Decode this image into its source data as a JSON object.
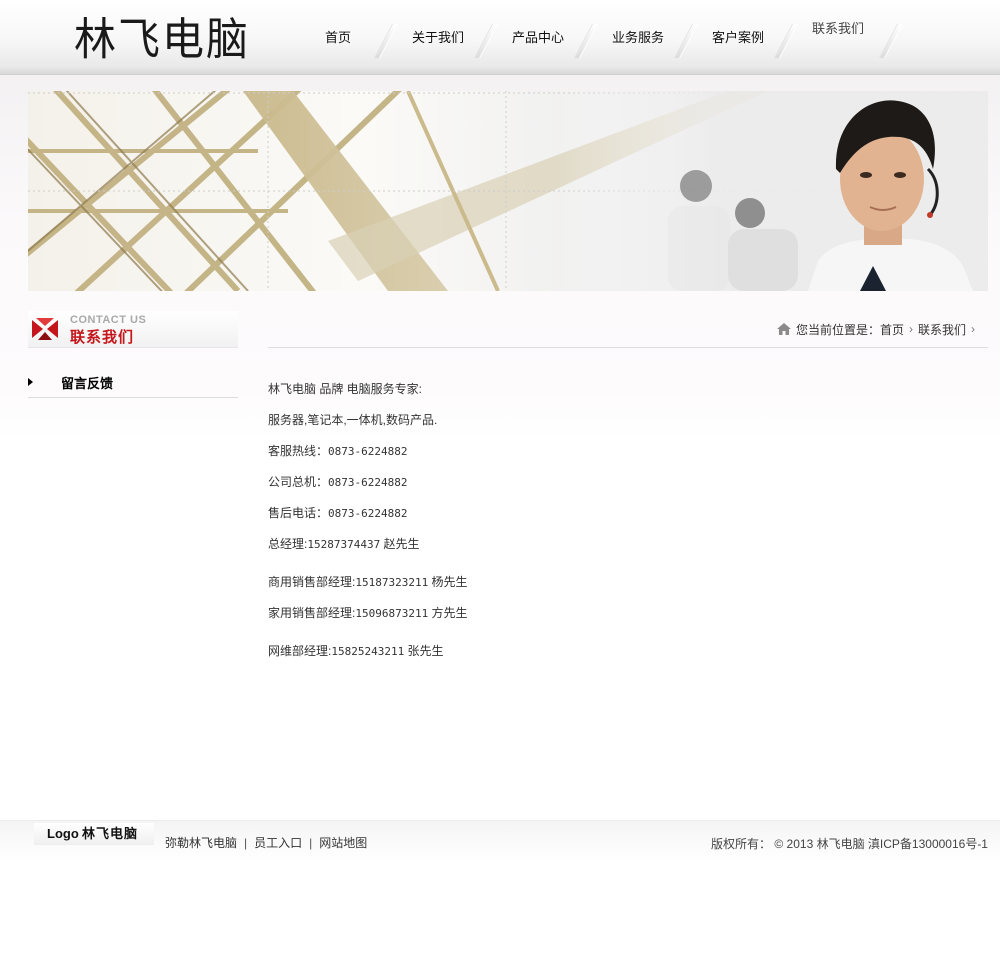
{
  "header": {
    "logo": "林飞电脑",
    "nav": [
      {
        "label": "首页"
      },
      {
        "label": "关于我们"
      },
      {
        "label": "产品中心"
      },
      {
        "label": "业务服务"
      },
      {
        "label": "客户案例"
      },
      {
        "label": "联系我们"
      }
    ]
  },
  "banner": {
    "description_icon": "customer-service-banner"
  },
  "sidebar": {
    "title_en": "CONTACT US",
    "title_cn": "联系我们",
    "items": [
      {
        "label": "留言反馈"
      }
    ]
  },
  "breadcrumb": {
    "prefix": "您当前位置是：",
    "items": [
      "首页",
      "联系我们"
    ]
  },
  "content": {
    "lines": [
      {
        "label": "林飞电脑  品牌 电脑服务专家:"
      },
      {
        "label": "服务器,笔记本,一体机,数码产品."
      },
      {
        "label": "客服热线：",
        "value": "0873-6224882"
      },
      {
        "label": "公司总机：",
        "value": "0873-6224882"
      },
      {
        "label": "售后电话：",
        "value": "0873-6224882"
      },
      {
        "label": "总经理:",
        "value": "15287374437",
        "suffix": " 赵先生"
      },
      {
        "label": "商用销售部经理:",
        "value": "15187323211",
        "suffix": " 杨先生"
      },
      {
        "label": "家用销售部经理:",
        "value": "15096873211",
        "suffix": " 方先生"
      },
      {
        "label": "网维部经理:",
        "value": "15825243211",
        "suffix": " 张先生"
      }
    ]
  },
  "footer": {
    "logo_en": "Logo",
    "logo_cn": "林飞电脑",
    "links": [
      "弥勒林飞电脑",
      "员工入口",
      "网站地图"
    ],
    "copyright": "版权所有： © 2013 林飞电脑  滇ICP备13000016号-1"
  },
  "colors": {
    "accent_red": "#c4161c",
    "text": "#333333"
  }
}
